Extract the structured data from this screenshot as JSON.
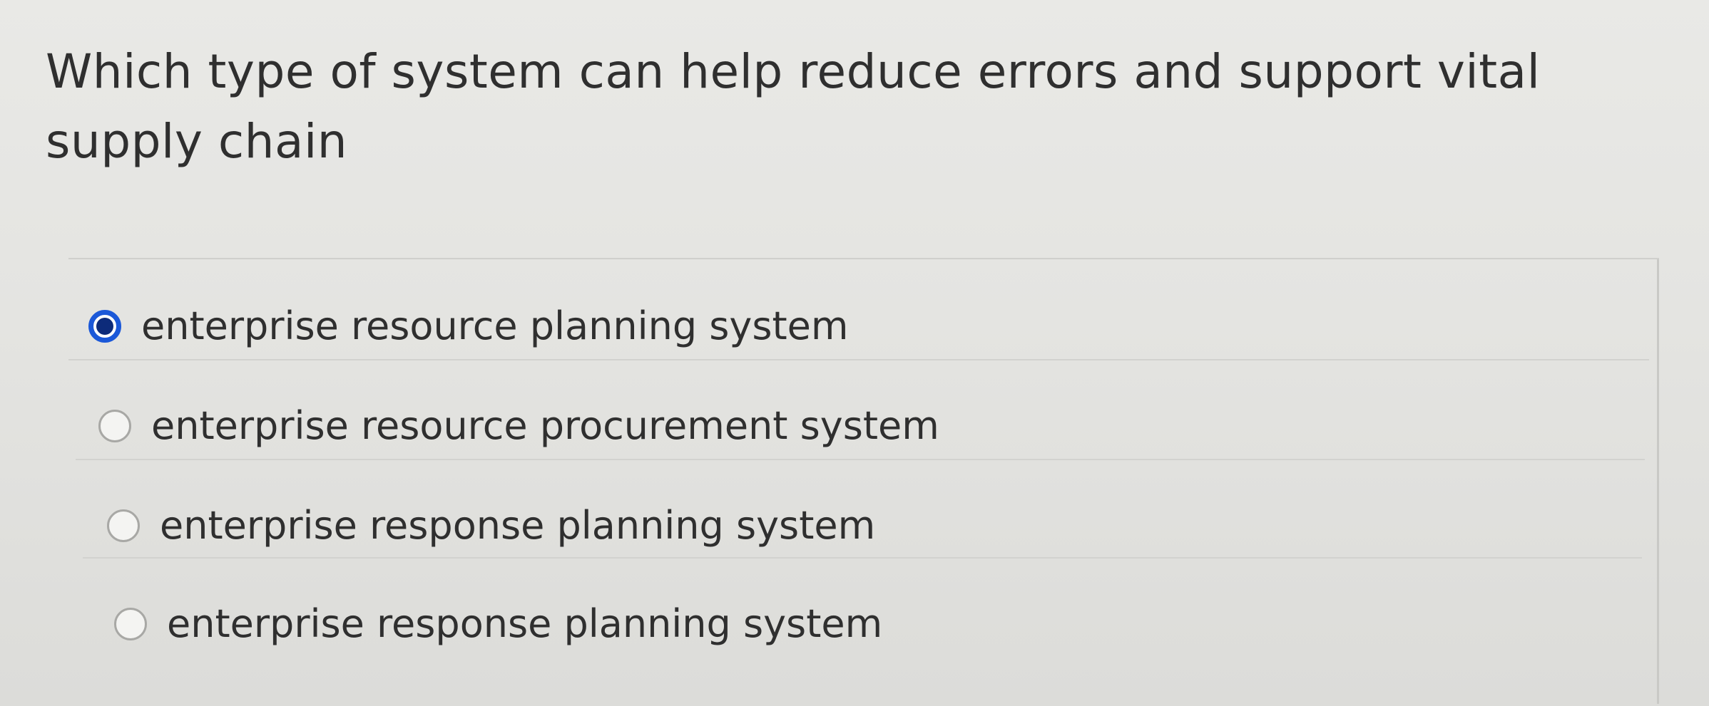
{
  "question": {
    "text": "Which type of system can help reduce errors and support vital supply chain"
  },
  "options": [
    {
      "label": "enterprise resource planning system",
      "selected": true
    },
    {
      "label": "enterprise resource procurement system",
      "selected": false
    },
    {
      "label": "enterprise response planning system",
      "selected": false
    },
    {
      "label": "enterprise response planning system",
      "selected": false
    }
  ],
  "colors": {
    "selected_radio": "#1b58d8",
    "text": "#2f2f2f",
    "background": "#e6e6e3"
  }
}
